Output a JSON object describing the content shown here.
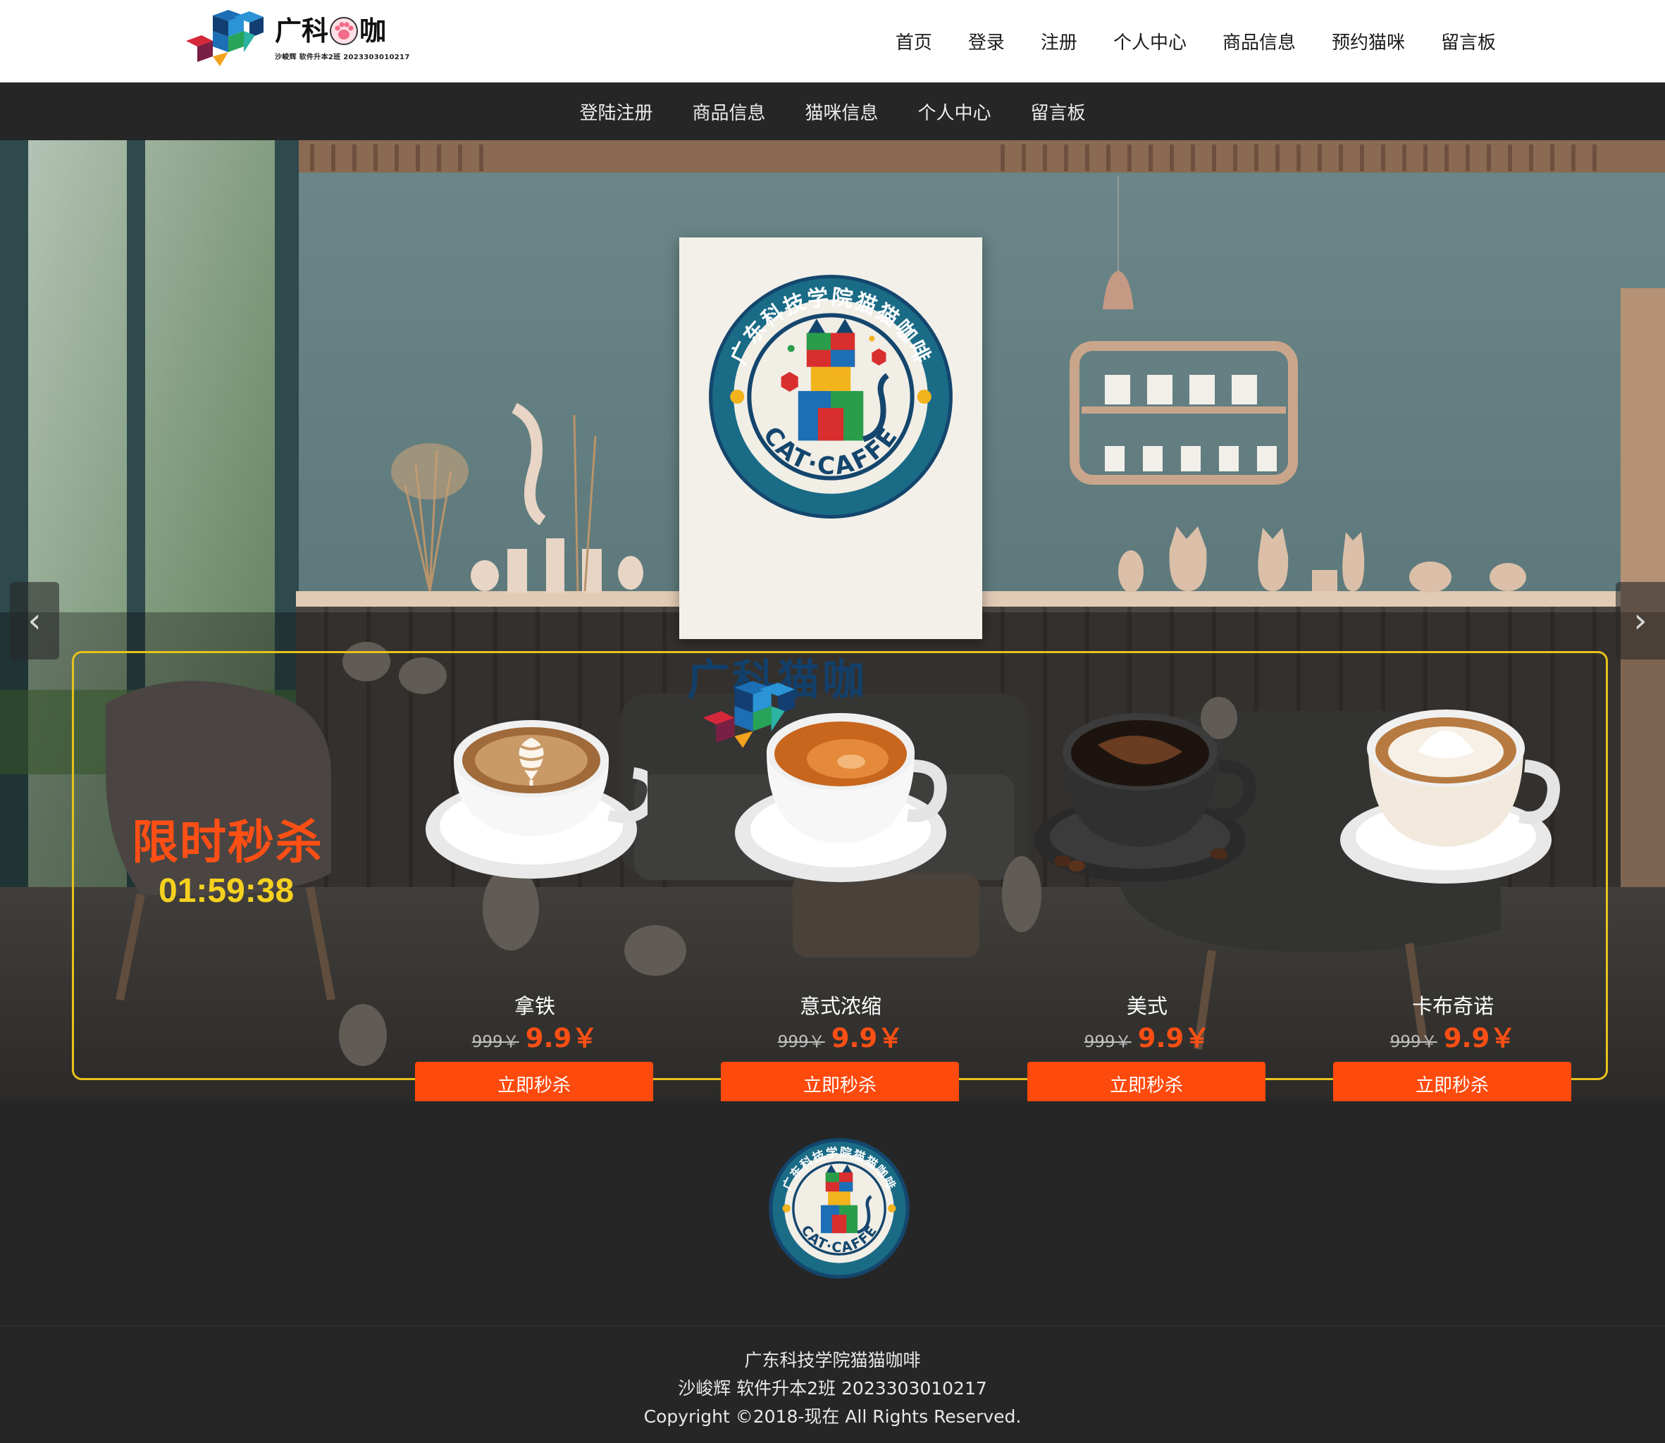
{
  "brand": {
    "title_left": "广科",
    "title_right": "咖",
    "subtitle": "沙峻辉 软件升本2班 2023303010217",
    "poster_text": "广科猫咖"
  },
  "top_nav": [
    "首页",
    "登录",
    "注册",
    "个人中心",
    "商品信息",
    "预约猫咪",
    "留言板"
  ],
  "sub_nav": [
    "登陆注册",
    "商品信息",
    "猫咪信息",
    "个人中心",
    "留言板"
  ],
  "carousel": {
    "prev_label": "‹",
    "next_label": "›"
  },
  "badge": {
    "ring_text": "广东科技学院猫猫咖啡",
    "bottom_text": "CAT·CAFFE"
  },
  "flash_sale": {
    "title": "限时秒杀",
    "countdown": "01:59:38",
    "products": [
      {
        "name": "拿铁",
        "old_price": "999￥",
        "new_price": "9.9￥",
        "button": "立即秒杀"
      },
      {
        "name": "意式浓缩",
        "old_price": "999￥",
        "new_price": "9.9￥",
        "button": "立即秒杀"
      },
      {
        "name": "美式",
        "old_price": "999￥",
        "new_price": "9.9￥",
        "button": "立即秒杀"
      },
      {
        "name": "卡布奇诺",
        "old_price": "999￥",
        "new_price": "9.9￥",
        "button": "立即秒杀"
      }
    ]
  },
  "footer": {
    "line1": "广东科技学院猫猫咖啡",
    "line2": "沙峻辉 软件升本2班 2023303010217",
    "line3": "Copyright ©2018-现在 All Rights Reserved."
  },
  "colors": {
    "accent": "#ff4a0d",
    "timer": "#f5d11f",
    "panel_border": "#e7c21c",
    "nav_dark": "#262626"
  }
}
